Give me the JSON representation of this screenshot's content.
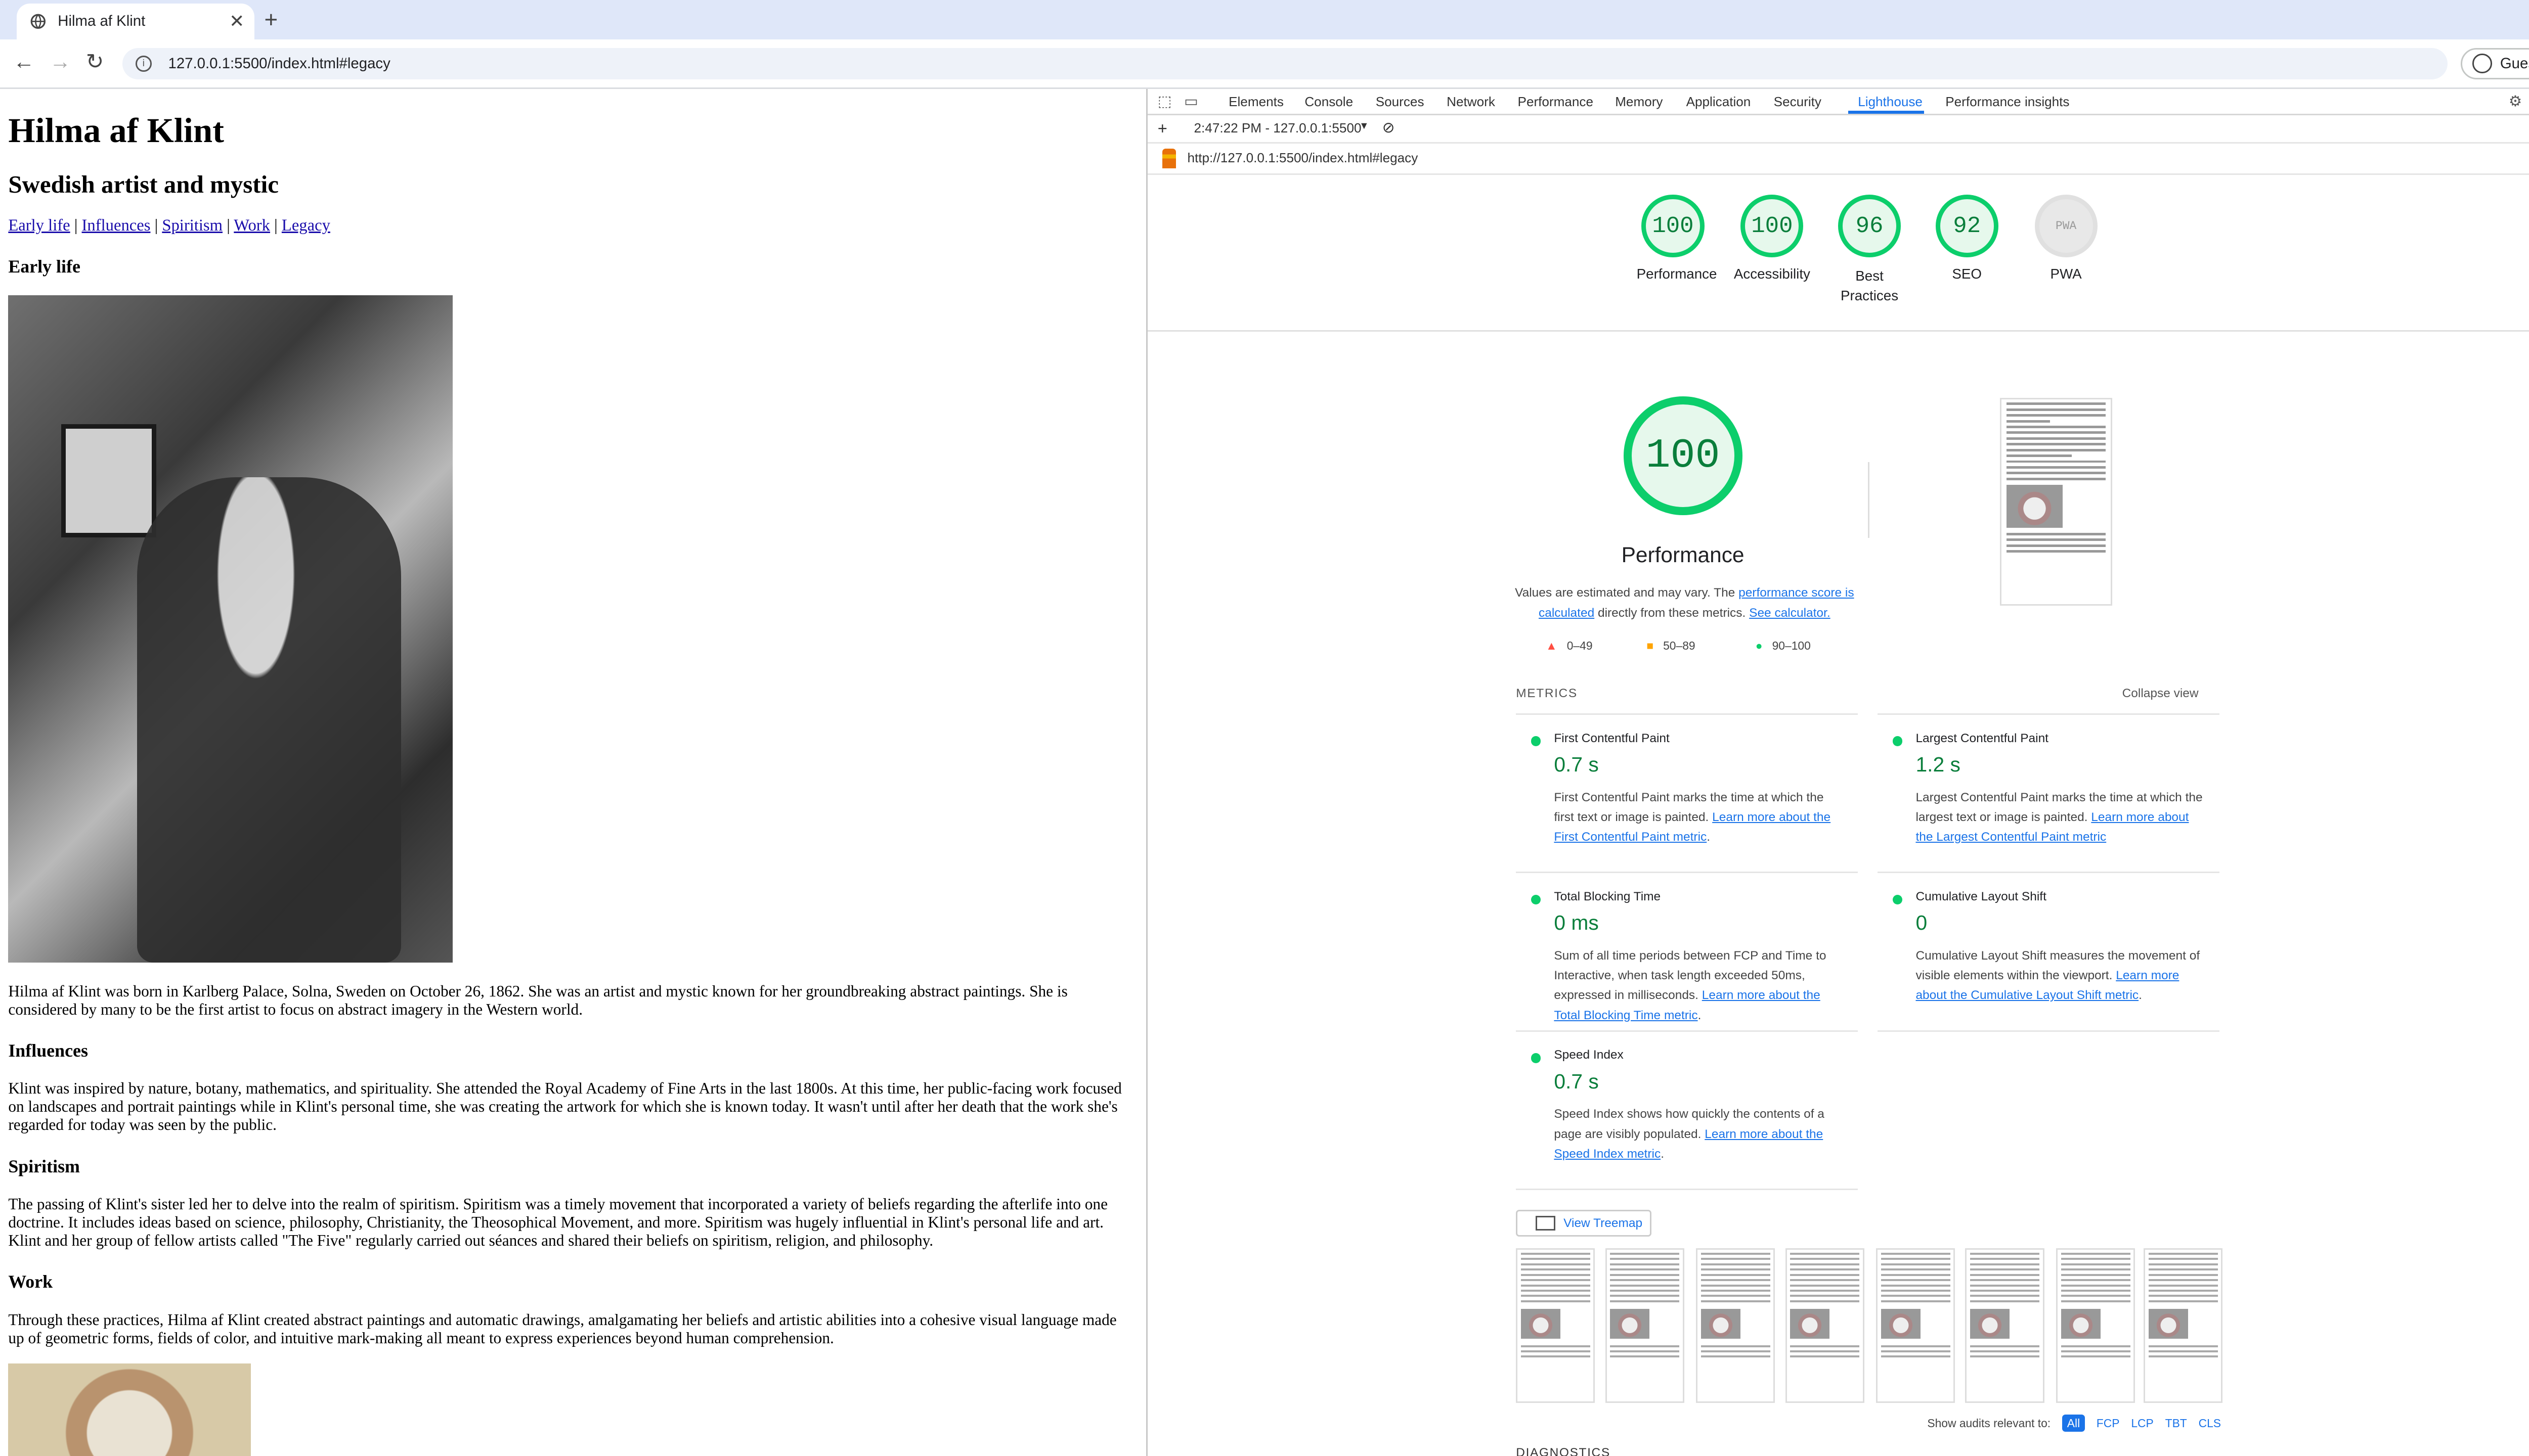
{
  "browser": {
    "tab_title": "Hilma af Klint",
    "url": "127.0.0.1:5500/index.html#legacy",
    "profile": "Guest"
  },
  "page": {
    "title": "Hilma af Klint",
    "subtitle": "Swedish artist and mystic",
    "nav": [
      "Early life",
      "Influences",
      "Spiritism",
      "Work",
      "Legacy"
    ],
    "sections": {
      "early_life": {
        "heading": "Early life",
        "text": "Hilma af Klint was born in Karlberg Palace, Solna, Sweden on October 26, 1862. She was an artist and mystic known for her groundbreaking abstract paintings. She is considered by many to be the first artist to focus on abstract imagery in the Western world."
      },
      "influences": {
        "heading": "Influences",
        "text": "Klint was inspired by nature, botany, mathematics, and spirituality. She attended the Royal Academy of Fine Arts in the last 1800s. At this time, her public-facing work focused on landscapes and portrait paintings while in Klint's personal time, she was creating the artwork for which she is known today. It wasn't until after her death that the work she's regarded for today was seen by the public."
      },
      "spiritism": {
        "heading": "Spiritism",
        "text": "The passing of Klint's sister led her to delve into the realm of spiritism. Spiritism was a timely movement that incorporated a variety of beliefs regarding the afterlife into one doctrine. It includes ideas based on science, philosophy, Christianity, the Theosophical Movement, and more. Spiritism was hugely influential in Klint's personal life and art. Klint and her group of fellow artists called \"The Five\" regularly carried out séances and shared their beliefs on spiritism, religion, and philosophy."
      },
      "work": {
        "heading": "Work",
        "text": "Through these practices, Hilma af Klint created abstract paintings and automatic drawings, amalgamating her beliefs and artistic abilities into a cohesive visual language made up of geometric forms, fields of color, and intuitive mark-making all meant to express experiences beyond human comprehension."
      }
    }
  },
  "devtools": {
    "tabs": [
      "Elements",
      "Console",
      "Sources",
      "Network",
      "Performance",
      "Memory",
      "Application",
      "Security",
      "Lighthouse",
      "Performance insights"
    ],
    "active_tab": "Lighthouse",
    "report_selector": "2:47:22 PM - 127.0.0.1:5500",
    "report_url": "http://127.0.0.1:5500/index.html#legacy",
    "scores": [
      {
        "label": "Performance",
        "value": "100"
      },
      {
        "label": "Accessibility",
        "value": "100"
      },
      {
        "label": "Best Practices",
        "value": "96"
      },
      {
        "label": "SEO",
        "value": "92"
      },
      {
        "label": "PWA",
        "value": "PWA"
      }
    ],
    "performance": {
      "score": "100",
      "title": "Performance",
      "desc_pre": "Values are estimated and may vary. The ",
      "desc_link1": "performance score is calculated",
      "desc_mid": " directly from these metrics. ",
      "desc_link2": "See calculator."
    },
    "legend": [
      "0–49",
      "50–89",
      "90–100"
    ],
    "metrics_heading": "METRICS",
    "collapse_label": "Collapse view",
    "metrics": [
      {
        "name": "First Contentful Paint",
        "value": "0.7 s",
        "desc": "First Contentful Paint marks the time at which the first text or image is painted. ",
        "link": "Learn more about the First Contentful Paint metric"
      },
      {
        "name": "Largest Contentful Paint",
        "value": "1.2 s",
        "desc": "Largest Contentful Paint marks the time at which the largest text or image is painted. ",
        "link": "Learn more about the Largest Contentful Paint metric"
      },
      {
        "name": "Total Blocking Time",
        "value": "0 ms",
        "desc": "Sum of all time periods between FCP and Time to Interactive, when task length exceeded 50ms, expressed in milliseconds. ",
        "link": "Learn more about the Total Blocking Time metric"
      },
      {
        "name": "Cumulative Layout Shift",
        "value": "0",
        "desc": "Cumulative Layout Shift measures the movement of visible elements within the viewport. ",
        "link": "Learn more about the Cumulative Layout Shift metric"
      },
      {
        "name": "Speed Index",
        "value": "0.7 s",
        "desc": "Speed Index shows how quickly the contents of a page are visibly populated. ",
        "link": "Learn more about the Speed Index metric"
      }
    ],
    "treemap_label": "View Treemap",
    "filter_label": "Show audits relevant to:",
    "filters": [
      "All",
      "FCP",
      "LCP",
      "TBT",
      "CLS"
    ],
    "diagnostics": "DIAGNOSTICS",
    "colors": {
      "pass": "#0cce6b",
      "average": "#ffa400",
      "fail": "#ff4e42",
      "link": "#1a73e8"
    }
  }
}
